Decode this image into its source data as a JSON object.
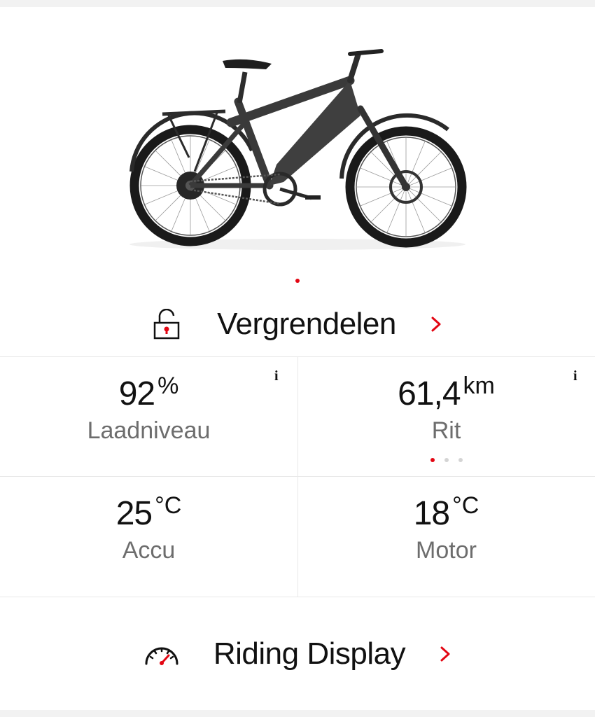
{
  "carousel": {
    "pages": 1,
    "active": 0
  },
  "lock": {
    "label": "Vergrendelen",
    "icon": "unlocked-padlock-icon"
  },
  "stats": [
    {
      "value": "92",
      "unit": "%",
      "label": "Laadniveau",
      "info": "i"
    },
    {
      "value": "61,4",
      "unit": "km",
      "label": "Rit",
      "info": "i",
      "pager": {
        "pages": 3,
        "active": 0
      }
    },
    {
      "value": "25",
      "unit": "°C",
      "label": "Accu"
    },
    {
      "value": "18",
      "unit": "°C",
      "label": "Motor"
    }
  ],
  "riding_display": {
    "label": "Riding Display",
    "icon": "speedometer-icon"
  },
  "colors": {
    "accent": "#e30613",
    "text": "#111111",
    "muted": "#6d6d6d",
    "divider": "#e8e8e8"
  }
}
